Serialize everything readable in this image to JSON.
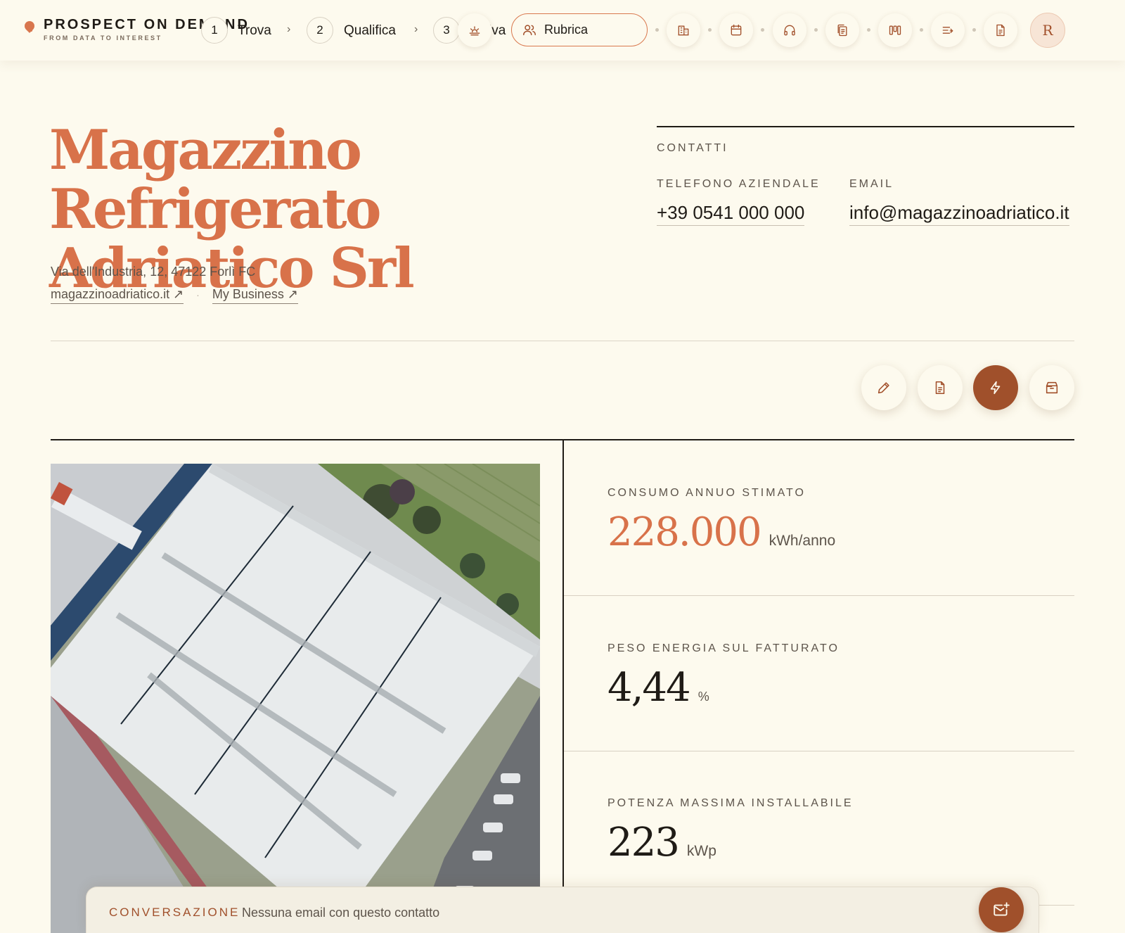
{
  "brand": {
    "name": "PROSPECT ON DEMAND",
    "tagline": "FROM DATA TO INTEREST"
  },
  "steps": [
    {
      "number": "1",
      "label": "Trova"
    },
    {
      "number": "2",
      "label": "Qualifica"
    },
    {
      "number": "3",
      "label": "iva"
    }
  ],
  "search": {
    "label": "Rubrica"
  },
  "nav_icons": [
    "sunrise-icon",
    "building-icon",
    "calendar-icon",
    "headset-icon",
    "documents-icon",
    "columns-icon",
    "sort-list-icon",
    "file-icon"
  ],
  "avatar": {
    "initial": "R"
  },
  "company": {
    "name": "Magazzino Refrigerato Adriatico Srl",
    "address": "Via dell'Industria, 12, 47122 Forlì FC",
    "website": "magazzinoadriatico.it ↗",
    "my_business": "My Business ↗",
    "link_separator": "·"
  },
  "contacts": {
    "section": "CONTATTI",
    "phone_label": "TELEFONO AZIENDALE",
    "phone": "+39 0541 000 000",
    "email_label": "EMAIL",
    "email": "info@magazzinoadriatico.it"
  },
  "actions": [
    "edit-icon",
    "document-icon",
    "lightning-icon",
    "archive-icon"
  ],
  "metrics": [
    {
      "label": "CONSUMO ANNUO STIMATO",
      "value": "228.000",
      "unit": "kWh/anno"
    },
    {
      "label": "PESO ENERGIA SUL FATTURATO",
      "value": "4,44",
      "unit": "%"
    },
    {
      "label": "POTENZA MASSIMA INSTALLABILE",
      "value": "223",
      "unit": "kWp"
    }
  ],
  "conversation": {
    "label": "CONVERSAZIONE",
    "text": "Nessuna email con questo contatto"
  },
  "colors": {
    "accent": "#d8724a",
    "accent_dark": "#a0502b",
    "background": "#fdfaee",
    "ink": "#1f1b16"
  }
}
